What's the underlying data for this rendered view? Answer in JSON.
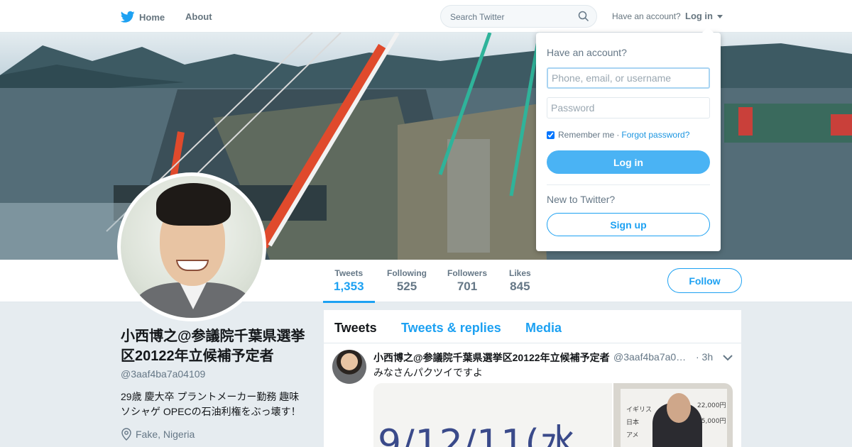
{
  "nav": {
    "home_label": "Home",
    "about_label": "About",
    "search_placeholder": "Search Twitter",
    "have_account": "Have an account?",
    "login_label": "Log in"
  },
  "profile": {
    "name": "小西博之@参議院千葉県選挙区20122年立候補予定者",
    "handle": "@3aaf4ba7a04109",
    "bio": "29歳 慶大卒 プラントメーカー勤務 趣味ソシャゲ OPECの石油利権をぶっ壊す！",
    "location": "Fake, Nigeria",
    "follow_label": "Follow"
  },
  "stats": [
    {
      "label": "Tweets",
      "value": "1,353"
    },
    {
      "label": "Following",
      "value": "525"
    },
    {
      "label": "Followers",
      "value": "701"
    },
    {
      "label": "Likes",
      "value": "845"
    }
  ],
  "timeline": {
    "tabs": [
      "Tweets",
      "Tweets & replies",
      "Media"
    ],
    "tweet": {
      "name": "小西博之@参議院千葉県選挙区20122年立候補予定者",
      "handle": "@3aaf4ba7a0…",
      "time": "· 3h",
      "text": "みなさんパクツイですよ",
      "media_text": "9/12/11(水",
      "board_notes": [
        "イギリス",
        "日本",
        "アメ",
        "22,000円",
        "25,000円"
      ]
    }
  },
  "login_dropdown": {
    "title": "Have an account?",
    "username_placeholder": "Phone, email, or username",
    "password_placeholder": "Password",
    "remember": "Remember me",
    "separator": "·",
    "forgot": "Forgot password?",
    "login_button": "Log in",
    "new_to": "New to Twitter?",
    "signup_button": "Sign up"
  },
  "colors": {
    "accent": "#1da1f2",
    "login_button": "#4ab3f4",
    "background": "#e6ecf0",
    "muted_text": "#657786"
  },
  "icons": [
    "twitter-bird-icon",
    "search-icon",
    "caret-down-icon",
    "location-pin-icon",
    "chevron-down-icon"
  ]
}
